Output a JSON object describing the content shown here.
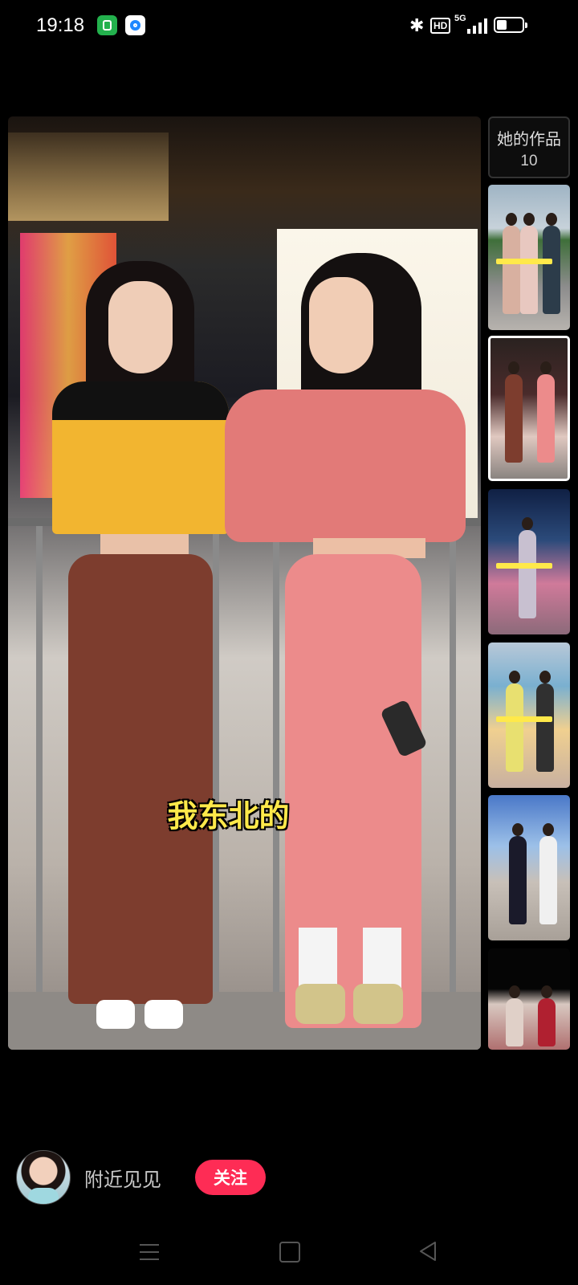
{
  "status_bar": {
    "time": "19:18",
    "hd": "HD",
    "network": "5G",
    "icons": [
      "notification-app-icon",
      "notification-app-icon",
      "bluetooth-icon",
      "hd-icon",
      "signal-icon",
      "battery-icon"
    ]
  },
  "video": {
    "caption": "我东北的"
  },
  "works": {
    "label": "她的作品",
    "count": "10",
    "thumbnails": [
      {
        "subtitle": "",
        "active": false
      },
      {
        "subtitle": "",
        "active": true
      },
      {
        "subtitle": "",
        "active": false
      },
      {
        "subtitle": "",
        "active": false
      },
      {
        "subtitle": "",
        "active": false
      },
      {
        "subtitle": "",
        "active": false
      }
    ]
  },
  "author": {
    "name": "附近见见",
    "follow_label": "关注"
  },
  "colors": {
    "follow_button": "#fe2c55",
    "caption": "#ffe94a",
    "background": "#000000"
  },
  "navbar": {
    "icons": [
      "menu-icon",
      "home-icon",
      "back-icon"
    ]
  }
}
